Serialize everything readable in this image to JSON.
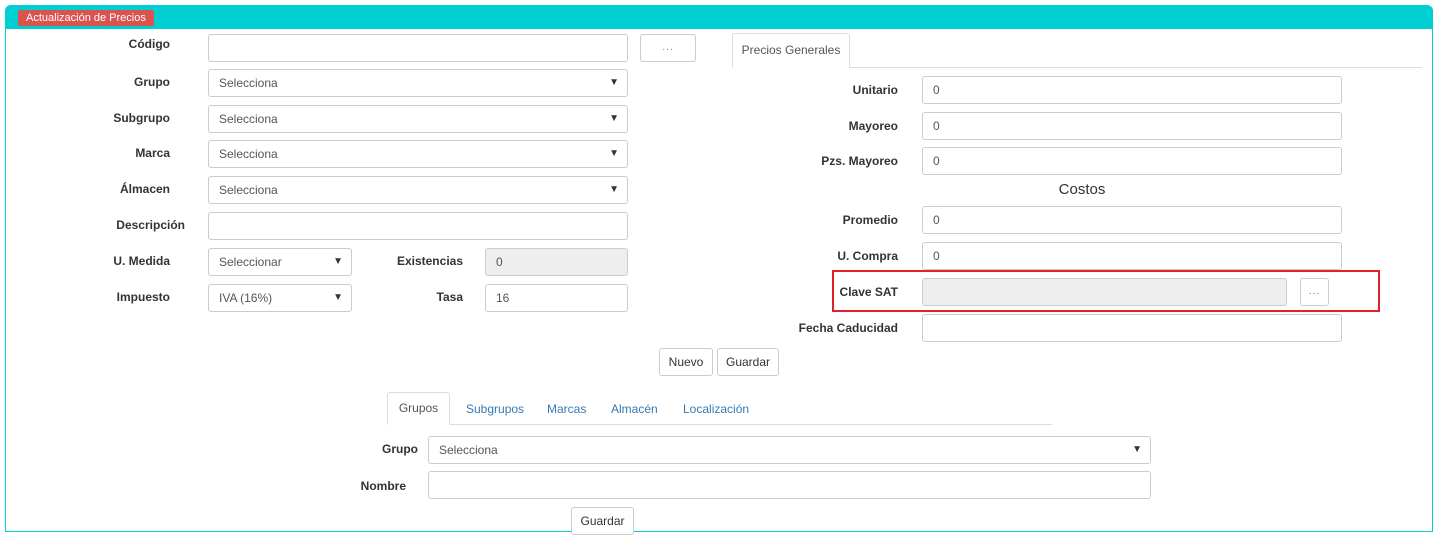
{
  "header": {
    "badge": "Actualización de Precios"
  },
  "left_form": {
    "codigo": {
      "label": "Código",
      "value": "",
      "browse_label": "..."
    },
    "grupo": {
      "label": "Grupo",
      "value": "Selecciona"
    },
    "subgrupo": {
      "label": "Subgrupo",
      "value": "Selecciona"
    },
    "marca": {
      "label": "Marca",
      "value": "Selecciona"
    },
    "almacen": {
      "label": "Álmacen",
      "value": "Selecciona"
    },
    "descripcion": {
      "label": "Descripción",
      "value": ""
    },
    "u_medida": {
      "label": "U. Medida",
      "value": "Seleccionar"
    },
    "existencias": {
      "label": "Existencias",
      "value": "0"
    },
    "impuesto": {
      "label": "Impuesto",
      "value": "IVA (16%)"
    },
    "tasa": {
      "label": "Tasa",
      "value": "16"
    }
  },
  "prices_panel": {
    "tab": "Precios Generales",
    "unitario": {
      "label": "Unitario",
      "value": "0"
    },
    "mayoreo": {
      "label": "Mayoreo",
      "value": "0"
    },
    "pzs_mayoreo": {
      "label": "Pzs. Mayoreo",
      "value": "0"
    },
    "costos_title": "Costos",
    "promedio": {
      "label": "Promedio",
      "value": "0"
    },
    "u_compra": {
      "label": "U. Compra",
      "value": "0"
    },
    "clave_sat": {
      "label": "Clave SAT",
      "value": "",
      "browse_label": "..."
    },
    "fecha_caducidad": {
      "label": "Fecha Caducidad",
      "value": ""
    }
  },
  "actions": {
    "nuevo": "Nuevo",
    "guardar": "Guardar"
  },
  "catalog": {
    "tabs": [
      "Grupos",
      "Subgrupos",
      "Marcas",
      "Almacén",
      "Localización"
    ],
    "active_tab": "Grupos",
    "grupo": {
      "label": "Grupo",
      "value": "Selecciona"
    },
    "nombre": {
      "label": "Nombre",
      "value": ""
    },
    "guardar": "Guardar"
  },
  "colors": {
    "header": "#00cfd1",
    "badge": "#d9534f",
    "highlight": "#e0202a",
    "link": "#337ab7"
  }
}
